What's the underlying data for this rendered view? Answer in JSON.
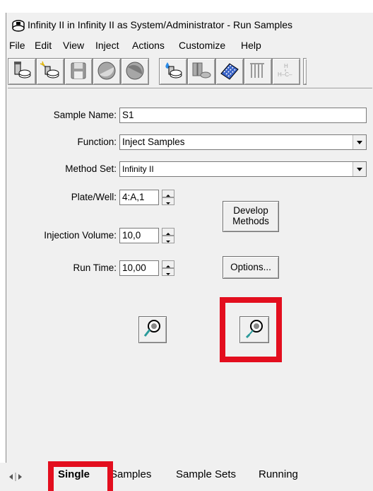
{
  "window": {
    "title": "Infinity II in Infinity II as System/Administrator - Run Samples"
  },
  "menu": [
    "File",
    "Edit",
    "View",
    "Inject",
    "Actions",
    "Customize",
    "Help"
  ],
  "toolbar": {
    "icons": [
      "vial-icon",
      "wand-vial-icon",
      "save-icon",
      "circle-icon",
      "circle-icon-2",
      "drop-vial-icon",
      "vials-icon",
      "plate-icon",
      "column-bars-icon",
      "chemical-formula-icon"
    ]
  },
  "form": {
    "sample_name": {
      "label": "Sample Name:",
      "value": "S1"
    },
    "function": {
      "label": "Function:",
      "value": "Inject Samples"
    },
    "method_set": {
      "label": "Method Set:",
      "value": "Infinity II"
    },
    "plate_well": {
      "label": "Plate/Well:",
      "value": "4:A,1"
    },
    "injection_volume": {
      "label": "Injection Volume:",
      "value": "10,0"
    },
    "run_time": {
      "label": "Run Time:",
      "value": "10,00"
    },
    "develop_methods": "Develop Methods",
    "options": "Options...",
    "action_icons": [
      "inject-probe-icon",
      "inject-probe-highlighted-icon"
    ]
  },
  "tabs": [
    "Single",
    "Samples",
    "Sample Sets",
    "Running"
  ],
  "highlight_color": "#e30e1e"
}
